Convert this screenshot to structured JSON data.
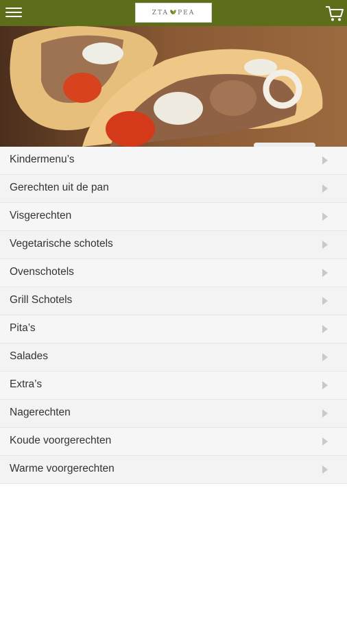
{
  "header": {
    "menu_icon": "hamburger-menu-icon",
    "logo_text_left": "ZTA",
    "logo_text_right": "PEA",
    "cart_icon": "shopping-cart-icon",
    "bar_color": "#5d6e1b"
  },
  "hero": {
    "image": "gyros-pita-photo"
  },
  "categories": [
    {
      "label": "Kindermenu’s"
    },
    {
      "label": "Gerechten uit de pan"
    },
    {
      "label": "Visgerechten"
    },
    {
      "label": "Vegetarische schotels"
    },
    {
      "label": "Ovenschotels"
    },
    {
      "label": "Grill Schotels"
    },
    {
      "label": "Pita’s"
    },
    {
      "label": "Salades"
    },
    {
      "label": "Extra’s"
    },
    {
      "label": "Nagerechten"
    },
    {
      "label": "Koude voorgerechten"
    },
    {
      "label": "Warme voorgerechten"
    }
  ]
}
